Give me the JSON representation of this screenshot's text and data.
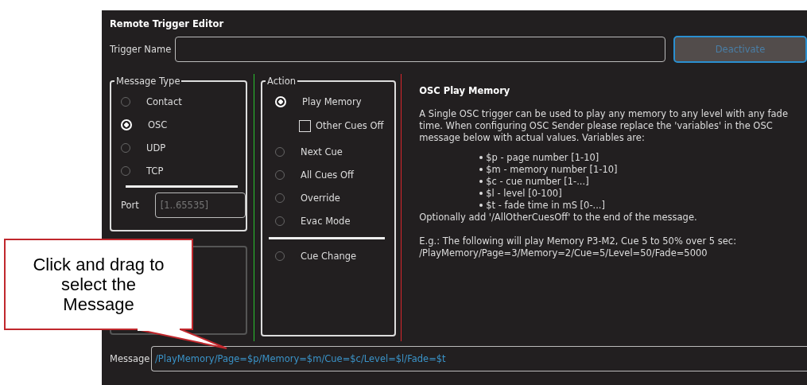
{
  "window": {
    "title": "Remote Trigger Editor"
  },
  "trigger_name": {
    "label": "Trigger Name"
  },
  "deactivate_button": {
    "label": "Deactivate",
    "disabled": true
  },
  "message_type": {
    "title": "Message Type",
    "options": [
      {
        "label": "Contact",
        "selected": false
      },
      {
        "label": "OSC",
        "selected": true
      },
      {
        "label": "UDP",
        "selected": false
      },
      {
        "label": "TCP",
        "selected": false
      }
    ],
    "port": {
      "label": "Port",
      "placeholder": "[1..65535]"
    }
  },
  "action": {
    "title": "Action",
    "items": [
      {
        "kind": "radio",
        "label": "Play Memory",
        "selected": true
      },
      {
        "kind": "checkbox",
        "label": "Other Cues Off",
        "checked": false
      },
      {
        "kind": "radio",
        "label": "Next Cue",
        "selected": false
      },
      {
        "kind": "radio",
        "label": "All Cues Off",
        "selected": false
      },
      {
        "kind": "radio",
        "label": "Override",
        "selected": false
      },
      {
        "kind": "radio",
        "label": "Evac Mode",
        "selected": false
      },
      {
        "kind": "divider"
      },
      {
        "kind": "radio",
        "label": "Cue Change",
        "selected": false
      }
    ]
  },
  "info": {
    "title": "OSC Play Memory",
    "paragraph": "A Single OSC trigger can be used to play any memory to any level with any fade time. When configuring OSC Sender please replace the 'variables' in the OSC message below with actual values. Variables are:",
    "bullets": [
      "$p - page number [1-10]",
      "$m - memory number [1-10]",
      "$c - cue number [1-...]",
      "$l - level [0-100]",
      "$t - fade time in mS [0-...]"
    ],
    "note": "Optionally add '/AllOtherCuesOff' to the end of the message.",
    "example_lines": [
      "E.g.: The following will play Memory P3-M2, Cue 5 to 50% over 5 sec:",
      "/PlayMemory/Page=3/Memory=2/Cue=5/Level=50/Fade=5000"
    ]
  },
  "message": {
    "label": "Message",
    "value": "/PlayMemory/Page=$p/Memory=$m/Cue=$c/Level=$l/Fade=$t"
  },
  "callout": {
    "text": "Click and drag to select the Message"
  }
}
